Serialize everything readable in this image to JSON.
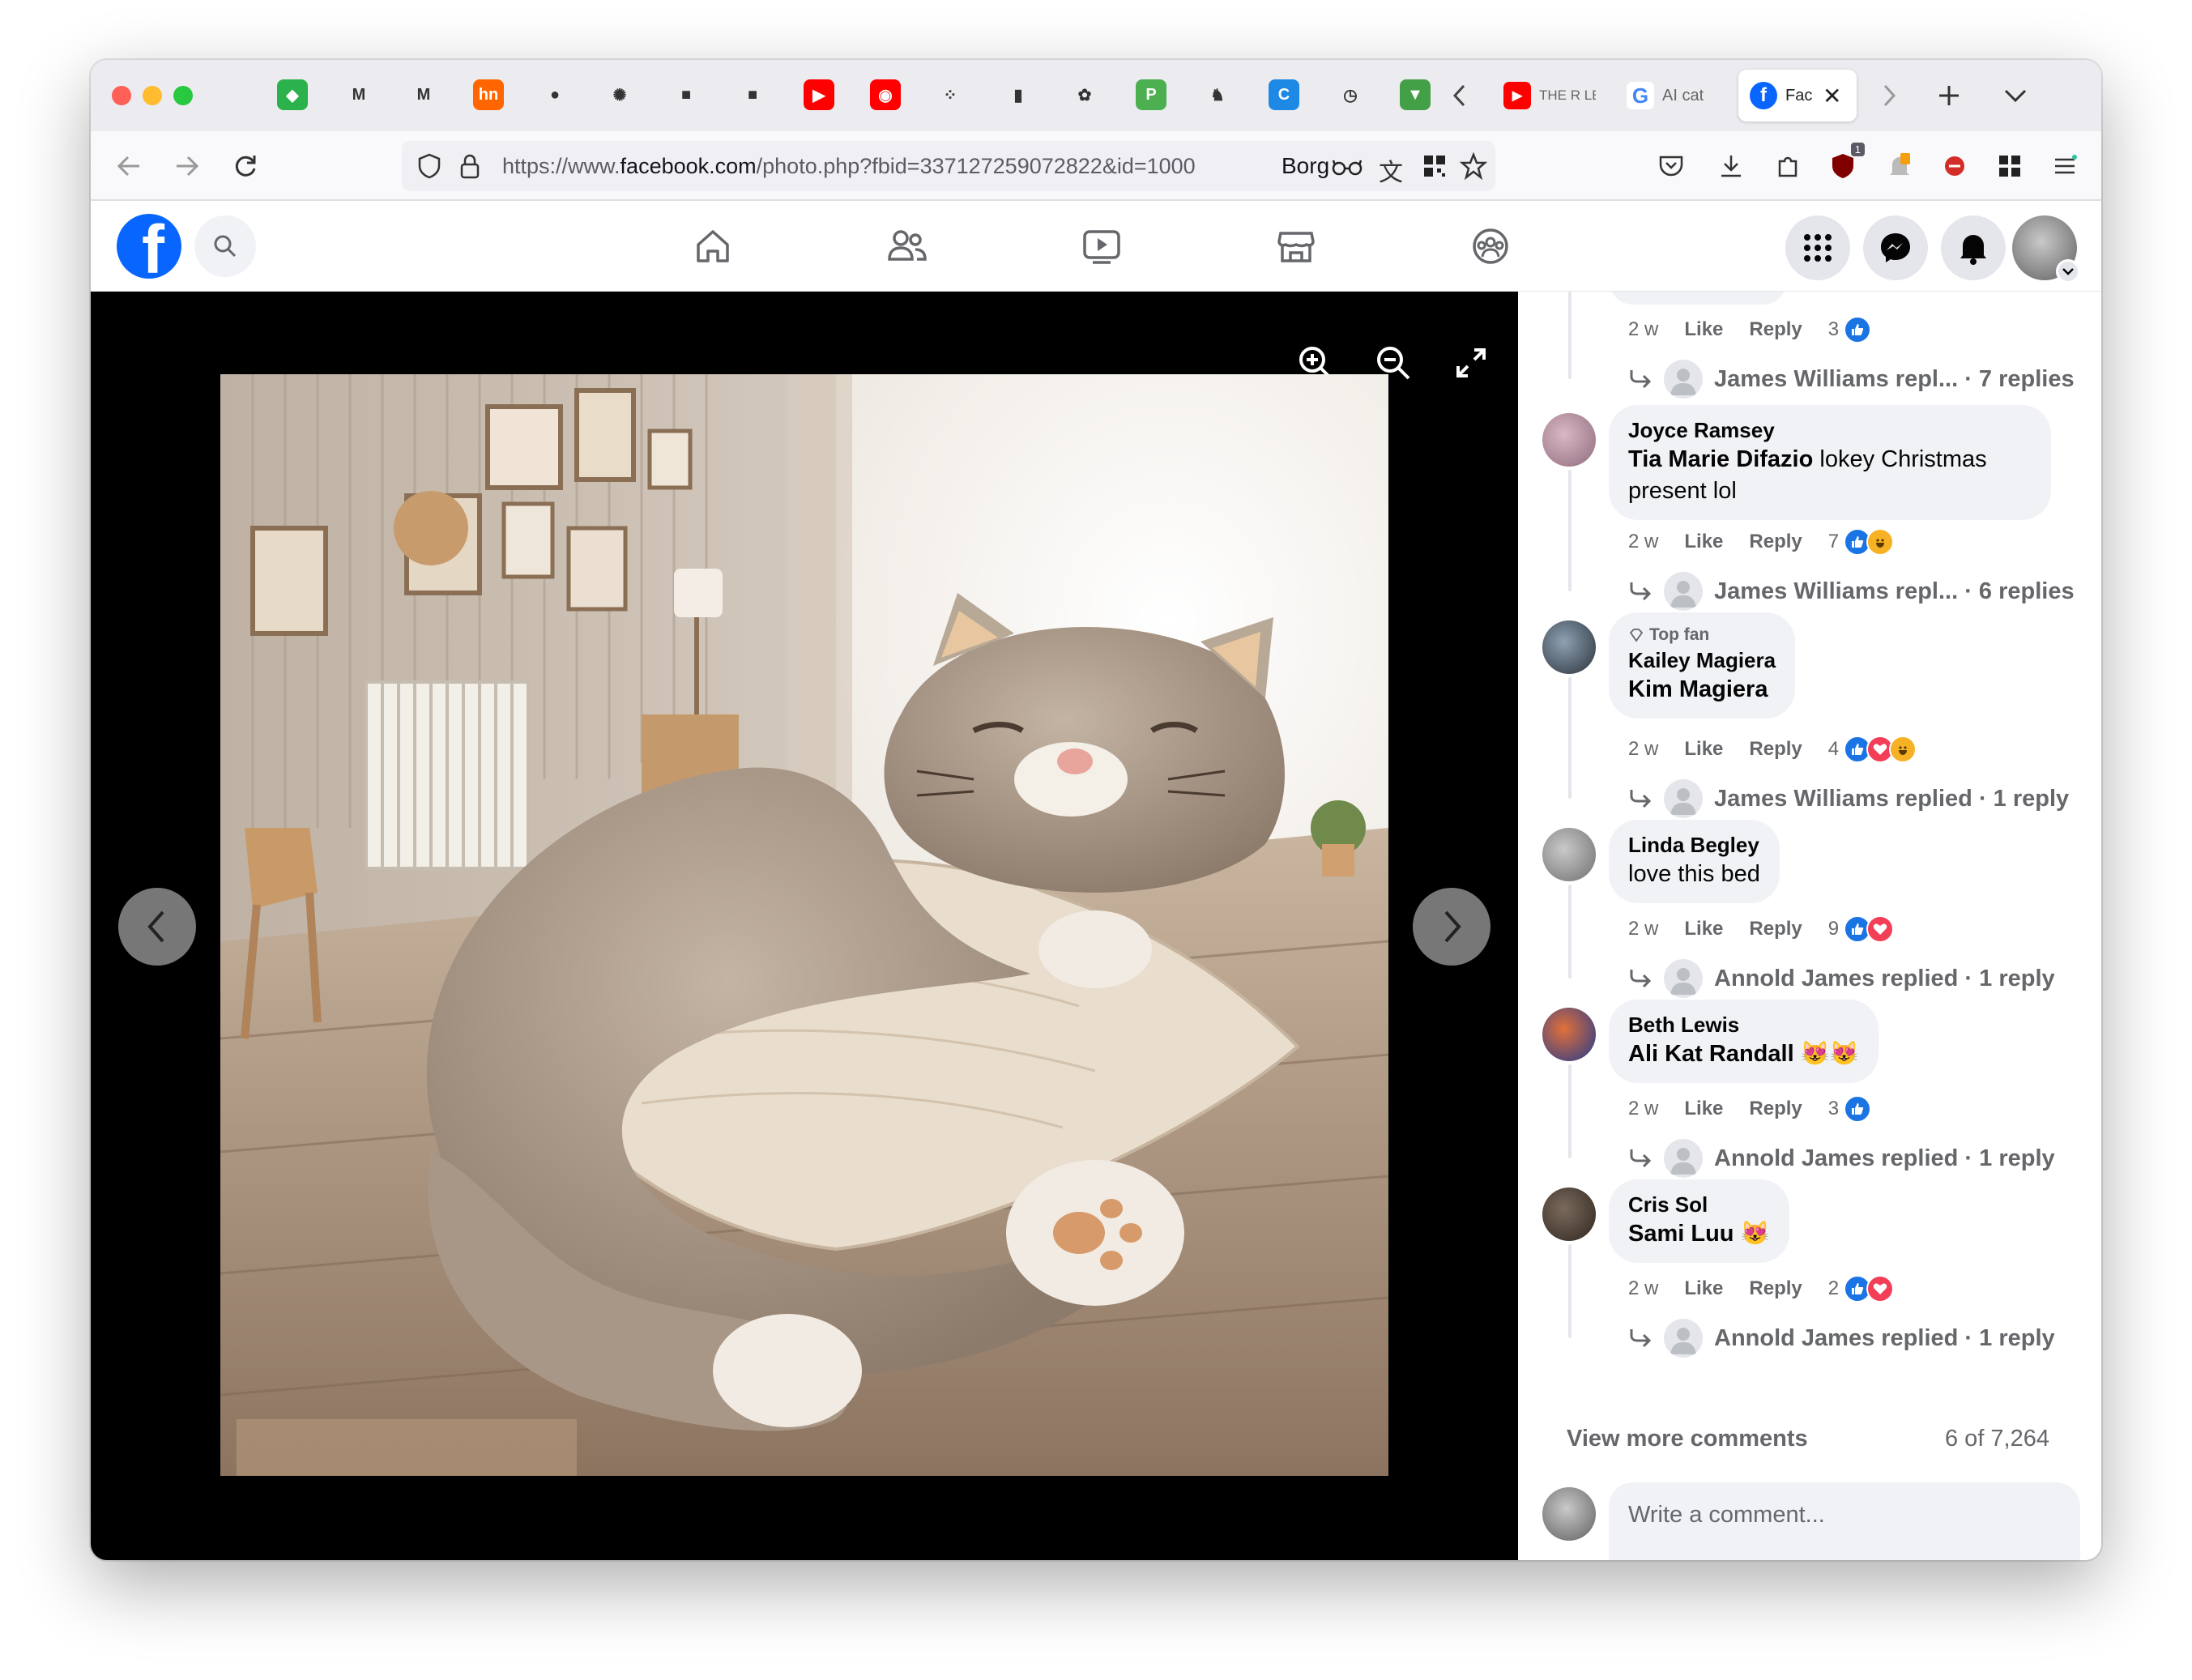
{
  "browser": {
    "pinned_tabs": [
      {
        "icon": "feedly-icon",
        "color": "#2bb24c",
        "glyph": "◆"
      },
      {
        "icon": "gmail-icon",
        "color": "#ffffff",
        "glyph": "M"
      },
      {
        "icon": "gmail-icon-2",
        "color": "#ffffff",
        "glyph": "M"
      },
      {
        "icon": "hackernews-icon",
        "color": "#ff6600",
        "glyph": "hn"
      },
      {
        "icon": "github-icon",
        "color": "#ffffff",
        "glyph": "●"
      },
      {
        "icon": "openai-icon",
        "color": "#ffffff",
        "glyph": "✺"
      },
      {
        "icon": "cube-icon",
        "color": "#ffffff",
        "glyph": "■"
      },
      {
        "icon": "cube-icon-2",
        "color": "#ffffff",
        "glyph": "■"
      },
      {
        "icon": "youtube-icon",
        "color": "#ff0000",
        "glyph": "▶"
      },
      {
        "icon": "youtube-music-icon",
        "color": "#ff0000",
        "glyph": "◉"
      },
      {
        "icon": "apps-grid-icon",
        "color": "#ffffff",
        "glyph": "⁘"
      },
      {
        "icon": "shopping-bag-icon",
        "color": "#ffffff",
        "glyph": "▮"
      },
      {
        "icon": "settings-flower-icon",
        "color": "#ffffff",
        "glyph": "✿"
      },
      {
        "icon": "pushbullet-icon",
        "color": "#4caf50",
        "glyph": "P"
      },
      {
        "icon": "camel-icon",
        "color": "#ffffff",
        "glyph": "♞"
      },
      {
        "icon": "c-icon",
        "color": "#1e88e5",
        "glyph": "C"
      },
      {
        "icon": "clock-icon",
        "color": "#ffffff",
        "glyph": "◷"
      },
      {
        "icon": "shield-icon",
        "color": "#43a047",
        "glyph": "▼"
      }
    ],
    "tabs": [
      {
        "title": "THE R LECTUR",
        "icon": "youtube-icon"
      },
      {
        "title": "AI cat",
        "icon": "google-icon"
      },
      {
        "title": "Fac",
        "icon": "facebook-icon",
        "active": true
      }
    ],
    "url_prefix": "https://www.",
    "url_domain": "facebook.com",
    "url_path": "/photo.php?fbid=337127259072822&id=1000",
    "url_extra": "Borg",
    "extension_badge": "1"
  },
  "viewer": {
    "controls": [
      "zoom-in-icon",
      "zoom-out-icon",
      "fullscreen-icon"
    ]
  },
  "comments": [
    {
      "id": "c0",
      "partial": true,
      "time": "2 w",
      "like": "Like",
      "reply": "Reply",
      "react_count": "3",
      "reactions": [
        "like"
      ],
      "replies_text": "James Williams repl... · 7 replies"
    },
    {
      "id": "c1",
      "name": "Joyce Ramsey",
      "mention": "Tia Marie Difazio",
      "text": " lokey Christmas present lol",
      "time": "2 w",
      "like": "Like",
      "reply": "Reply",
      "react_count": "7",
      "reactions": [
        "like",
        "haha"
      ],
      "replies_text": "James Williams repl... · 6 replies"
    },
    {
      "id": "c2",
      "badge": "Top fan",
      "name": "Kailey Magiera",
      "mention": "Kim Magiera",
      "text": "",
      "time": "2 w",
      "like": "Like",
      "reply": "Reply",
      "react_count": "4",
      "reactions": [
        "like",
        "love",
        "haha"
      ],
      "replies_text": "James Williams replied · 1 reply"
    },
    {
      "id": "c3",
      "name": "Linda Begley",
      "mention": "",
      "text": "love this bed",
      "time": "2 w",
      "like": "Like",
      "reply": "Reply",
      "react_count": "9",
      "reactions": [
        "like",
        "love"
      ],
      "replies_text": "Annold James replied · 1 reply"
    },
    {
      "id": "c4",
      "name": "Beth Lewis",
      "mention": "Ali Kat Randall",
      "text": " 😻😻",
      "time": "2 w",
      "like": "Like",
      "reply": "Reply",
      "react_count": "3",
      "reactions": [
        "like"
      ],
      "replies_text": "Annold James replied · 1 reply"
    },
    {
      "id": "c5",
      "name": "Cris Sol",
      "mention": "Sami Luu",
      "text": " 😻",
      "time": "2 w",
      "like": "Like",
      "reply": "Reply",
      "react_count": "2",
      "reactions": [
        "like",
        "love"
      ],
      "replies_text": "Annold James replied · 1 reply"
    }
  ],
  "view_more": "View more comments",
  "comment_count": "6 of 7,264",
  "composer": {
    "placeholder": "Write a comment...",
    "icons": [
      "avatar-sticker-icon",
      "emoji-icon",
      "camera-icon",
      "gif-icon",
      "sticker-icon",
      "send-icon"
    ]
  },
  "colors": {
    "facebook_blue": "#0866ff",
    "like": "#1b74e4",
    "love": "#f33e58",
    "haha": "#f7b125"
  }
}
